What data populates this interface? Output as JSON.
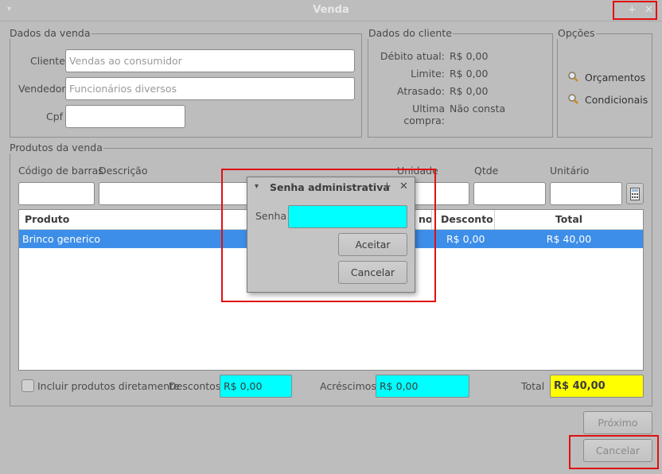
{
  "window": {
    "title": "Venda",
    "menu_icon": "triangle-down-icon",
    "pin_icon": "pin-icon",
    "close_icon": "close-icon"
  },
  "dados_venda": {
    "group_label": "Dados da venda",
    "cliente_label": "Cliente",
    "cliente_value": "Vendas ao consumidor",
    "vendedor_label": "Vendedor",
    "vendedor_value": "Funcionários diversos",
    "cpf_label": "Cpf",
    "cpf_value": ""
  },
  "dados_cliente": {
    "group_label": "Dados do cliente",
    "rows": [
      {
        "label": "Débito atual:",
        "value": "R$ 0,00"
      },
      {
        "label": "Limite:",
        "value": "R$ 0,00"
      },
      {
        "label": "Atrasado:",
        "value": "R$ 0,00"
      },
      {
        "label": "Ultima compra:",
        "value": "Não consta"
      }
    ]
  },
  "opcoes": {
    "group_label": "Opções",
    "items": [
      {
        "label": "Orçamentos",
        "icon": "magnifier-icon"
      },
      {
        "label": "Condicionais",
        "icon": "magnifier-icon"
      }
    ]
  },
  "produtos": {
    "group_label": "Produtos da venda",
    "field_labels": {
      "codigo": "Código de barras",
      "descricao": "Descrição",
      "unidade": "Unidade",
      "qtde": "Qtde",
      "unitario": "Unitário"
    },
    "calculator_icon": "calculator-icon",
    "columns": {
      "produto": "Produto",
      "col_hidden": "no",
      "desconto": "Desconto",
      "total": "Total"
    },
    "rows": [
      {
        "produto": "Brinco generico",
        "desconto": "R$ 0,00",
        "total": "R$ 40,00"
      }
    ],
    "incluir_label": "Incluir produtos diretamente",
    "descontos_label": "Descontos",
    "descontos_value": "R$ 0,00",
    "acrescimos_label": "Acréscimos",
    "acrescimos_value": "R$ 0,00",
    "total_label": "Total",
    "total_value": "R$ 40,00"
  },
  "buttons": {
    "proximo": "Próximo",
    "cancelar": "Cancelar"
  },
  "dialog": {
    "title": "Senha administrativa",
    "senha_label": "Senha",
    "senha_value": "",
    "aceitar": "Aceitar",
    "cancelar": "Cancelar"
  },
  "colors": {
    "accent_selection": "#3d8ee8",
    "input_highlight": "#00ffff",
    "total_highlight": "#ffff00",
    "annotation_red": "#e01010"
  }
}
